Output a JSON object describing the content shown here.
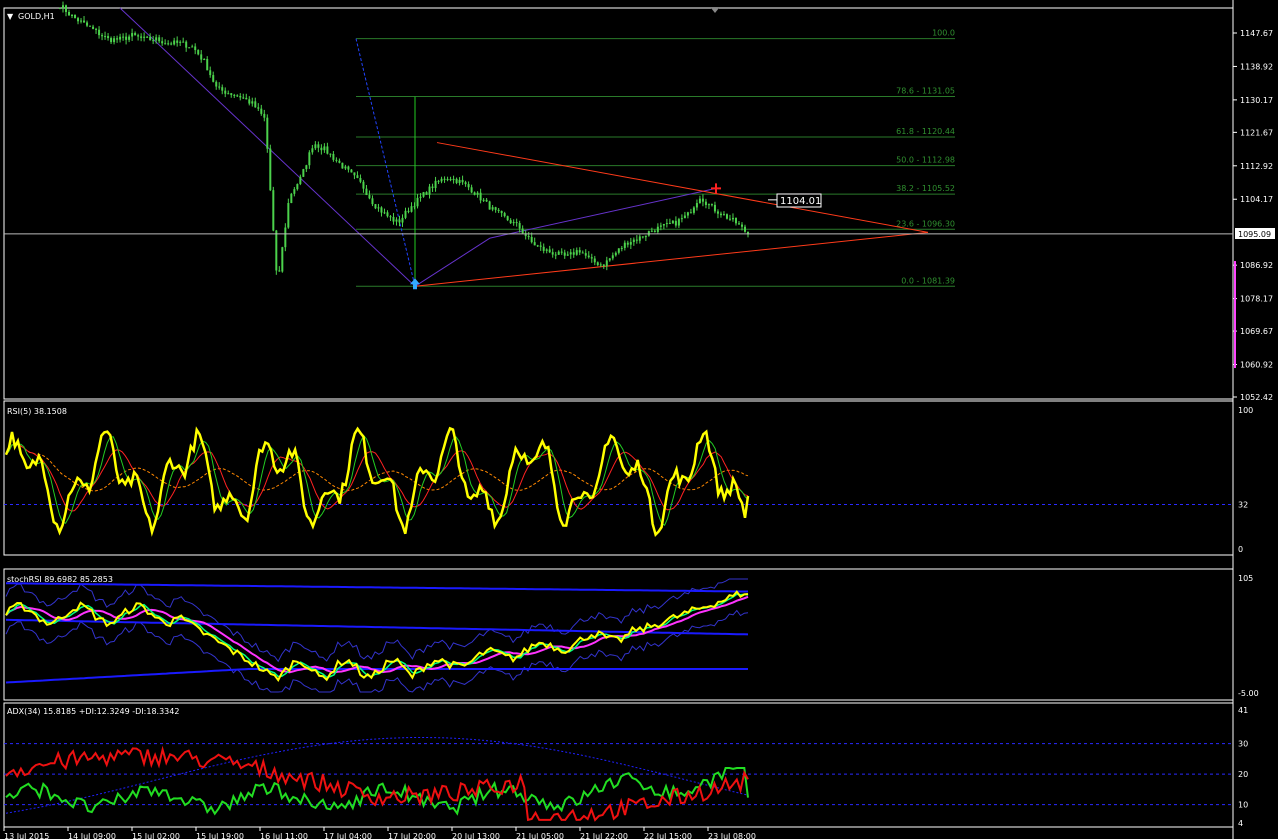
{
  "colors": {
    "bg": "#000000",
    "frame": "#ffffff",
    "candle": "#4cd24c",
    "fib_line": "#2a7a2a",
    "fib_text": "#2f8f2f",
    "triangle": "#ff3b1a",
    "rsi_main": "#ffff00",
    "stoch_band": "#1a1aff",
    "stoch_main": "#ffff00",
    "stoch_sig": "#00ff7f",
    "stoch_ma": "#ff33ff",
    "adx_plus": "#22dd22",
    "adx_minus": "#ee1111",
    "adx_line": "#2020ff",
    "dashed_level": "#2a2aff"
  },
  "main": {
    "title": "GOLD,H1",
    "current_price_label": "1095.09",
    "marker_label": "1104.01",
    "price_ticks": [
      "1147.67",
      "1138.92",
      "1130.17",
      "1121.67",
      "1112.92",
      "1104.17",
      "1095.09",
      "1086.92",
      "1078.17",
      "1069.67",
      "1060.92",
      "1052.42"
    ],
    "fib_labels": [
      "100.0",
      "78.6 - 1131.05",
      "61.8 - 1120.44",
      "50.0 - 1112.98",
      "38.2 - 1105.52",
      "23.6 - 1096.30",
      "0.0 - 1081.39"
    ]
  },
  "rsi": {
    "title": "RSI(5) 38.1508",
    "ticks": [
      "100",
      "32",
      "0"
    ]
  },
  "stoch": {
    "title": "stochRSI 89.6982 85.2853",
    "ticks": [
      "105",
      "-5.00"
    ]
  },
  "adx": {
    "title": "ADX(34) 15.8185 +DI:12.3249 -DI:18.3342",
    "ticks": [
      "41",
      "30",
      "20",
      "10",
      "4"
    ]
  },
  "time_axis": [
    "13 Jul 2015",
    "14 Jul 09:00",
    "15 Jul 02:00",
    "15 Jul 19:00",
    "16 Jul 11:00",
    "17 Jul 04:00",
    "17 Jul 20:00",
    "20 Jul 13:00",
    "21 Jul 05:00",
    "21 Jul 22:00",
    "22 Jul 15:00",
    "23 Jul 08:00"
  ],
  "chart_data": {
    "type": "line",
    "title": "GOLD,H1",
    "symbol": "GOLD",
    "timeframe": "H1",
    "ylim": [
      1052.42,
      1152
    ],
    "price_path_close": [
      1155,
      1152,
      1150,
      1148,
      1146,
      1146,
      1147,
      1146,
      1146,
      1145,
      1145,
      1144,
      1140,
      1133,
      1132,
      1131,
      1129,
      1125,
      1081.4,
      1105,
      1110,
      1119,
      1117,
      1114,
      1111,
      1108,
      1103,
      1100,
      1098,
      1102,
      1105,
      1108,
      1110,
      1109,
      1107,
      1104,
      1101,
      1099,
      1097,
      1093,
      1091,
      1090,
      1089,
      1091,
      1088,
      1087,
      1090,
      1093,
      1094,
      1096,
      1097,
      1098,
      1100,
      1105,
      1102,
      1100,
      1098,
      1095.09
    ],
    "fibonacci": [
      {
        "level": "100.0",
        "price": 1146.2
      },
      {
        "level": "78.6",
        "price": 1131.05
      },
      {
        "level": "61.8",
        "price": 1120.44
      },
      {
        "level": "50.0",
        "price": 1112.98
      },
      {
        "level": "38.2",
        "price": 1105.52
      },
      {
        "level": "23.6",
        "price": 1096.3
      },
      {
        "level": "0.0",
        "price": 1081.39
      }
    ],
    "last_price": 1095.09,
    "marked_price": 1104.01,
    "indicators": [
      {
        "name": "RSI(5)",
        "last": 38.1508,
        "levels": [
          32
        ],
        "ylim": [
          0,
          100
        ]
      },
      {
        "name": "stochRSI",
        "last": [
          89.6982,
          85.2853
        ],
        "ylim": [
          -5,
          105
        ]
      },
      {
        "name": "ADX(34)",
        "adx": 15.8185,
        "plus_di": 12.3249,
        "minus_di": 18.3342,
        "levels": [
          10,
          20,
          30
        ],
        "ylim": [
          4,
          41
        ]
      }
    ]
  }
}
